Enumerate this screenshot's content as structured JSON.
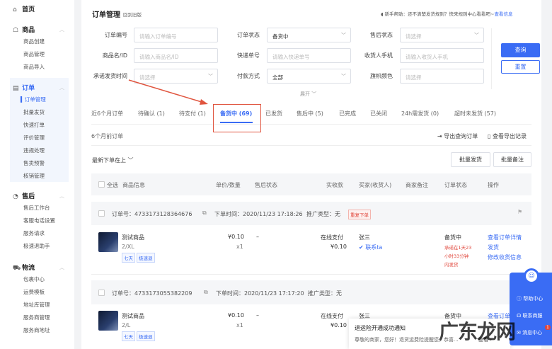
{
  "sidebar": {
    "home": "首页",
    "groups": [
      {
        "label": "商品",
        "items": [
          "商品创建",
          "商品管理",
          "商品导入"
        ]
      },
      {
        "label": "订单",
        "items": [
          "订单管理",
          "批量发货",
          "快速打单",
          "评价管理",
          "违规处理",
          "售卖预警",
          "核销管理"
        ]
      },
      {
        "label": "售后",
        "items": [
          "售后工作台",
          "客服电话设置",
          "服务请求",
          "极速退助手"
        ]
      },
      {
        "label": "物流",
        "items": [
          "包裹中心",
          "运费模板",
          "地址库管理",
          "服务商管理",
          "服务商地址"
        ]
      }
    ]
  },
  "header": {
    "title": "订单管理",
    "back_old": "回到旧版",
    "help_text": "新手帮助：还不清楚发货规则？快来规则中心看看吧~",
    "help_link": "查看信息"
  },
  "filters": {
    "order_no": {
      "label": "订单编号",
      "placeholder": "请输入订单编号"
    },
    "order_status": {
      "label": "订单状态",
      "value": "备货中"
    },
    "after_status": {
      "label": "售后状态",
      "placeholder": "请选择"
    },
    "product": {
      "label": "商品名/ID",
      "placeholder": "请输入商品名/ID"
    },
    "express": {
      "label": "快递单号",
      "placeholder": "请输入快递单号"
    },
    "phone": {
      "label": "收货人手机",
      "placeholder": "请输入收货人手机"
    },
    "ship_time": {
      "label": "承诺发货时间",
      "placeholder": "请选择"
    },
    "pay": {
      "label": "付款方式",
      "value": "全部"
    },
    "flag": {
      "label": "旗帜颜色",
      "placeholder": "请选择"
    },
    "query": "查询",
    "reset": "重置",
    "expand": "展开"
  },
  "tabs": [
    "近6个月订单",
    "待确认 (1)",
    "待支付 (1)",
    "备货中 (69)",
    "已发货",
    "售后中 (5)",
    "已完成",
    "已关闭",
    "24h需发货 (0)",
    "超时未发货 (57)"
  ],
  "toolbar": {
    "old_orders": "6个月前订单",
    "export": "导出查询订单",
    "export_log": "查看导出记录",
    "sort": "最新下单在上",
    "batch_ship": "批量发货",
    "batch_note": "批量备注"
  },
  "table_header": [
    "全选",
    "商品信息",
    "单价/数量",
    "售后状态",
    "实收款",
    "买家(收货人)",
    "商家备注",
    "订单状态",
    "操作"
  ],
  "orders": [
    {
      "no": "订单号：4733173128364676",
      "time": "下单时间：2020/11/23 17:18:26",
      "promo": "推广类型：无",
      "badge": "重复下单",
      "name": "测试商品",
      "sku": "2/XL",
      "tags": [
        "七天",
        "极速退"
      ],
      "price": "¥0.10",
      "qty": "x1",
      "after": "–",
      "pay": "在线支付",
      "paid": "¥0.10",
      "buyer": "张三",
      "contact": "联系ta",
      "status": "备货中",
      "deadline": [
        "承诺在1天23",
        "小时33分钟",
        "内发货"
      ],
      "ops": [
        "查看订单详情",
        "发货",
        "修改收货信息"
      ]
    },
    {
      "no": "订单号：4733173055382209",
      "time": "下单时间：2020/11/23 17:17:20",
      "promo": "推广类型：无",
      "name": "测试商品",
      "sku": "2/L",
      "tags": [
        "七天",
        "极速退"
      ],
      "price": "¥0.10",
      "qty": "x1",
      "after": "–",
      "pay": "在线支付",
      "paid": "¥0.10",
      "buyer": "张三",
      "status": "备货中",
      "ops": [
        "查看订单详情"
      ]
    }
  ],
  "widget": {
    "help": "帮助中心",
    "service": "联系商服",
    "messages": "消息中心",
    "badge": "1"
  },
  "notice": {
    "title": "退运险开通成功通知",
    "body": "尊敬的商家，您好！退货运费险提醒您，恭喜...",
    "view": "查看"
  },
  "watermark": "广东龙网",
  "colors": {
    "accent": "#3a6cf4",
    "highlight": "#e0453a"
  }
}
